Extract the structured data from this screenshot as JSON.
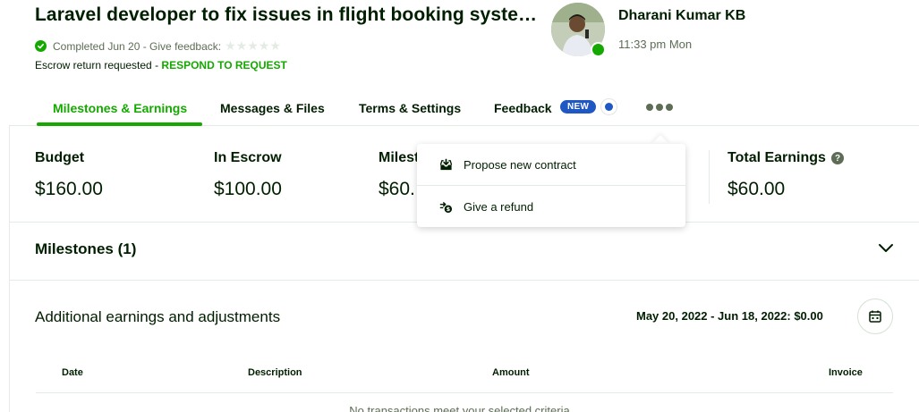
{
  "header": {
    "title": "Laravel developer to fix issues in flight booking syste…",
    "status_text": "Completed Jun 20 - Give feedback:",
    "stars": "★★★★★",
    "escrow_text": "Escrow return requested - ",
    "respond_link": "RESPOND TO REQUEST"
  },
  "user": {
    "name": "Dharani Kumar KB",
    "time": "11:33 pm Mon"
  },
  "tabs": [
    {
      "label": "Milestones & Earnings",
      "active": true
    },
    {
      "label": "Messages & Files"
    },
    {
      "label": "Terms & Settings"
    },
    {
      "label": "Feedback",
      "badge": "NEW"
    }
  ],
  "stats": [
    {
      "label": "Budget",
      "value": "$160.00"
    },
    {
      "label": "In Escrow",
      "value": "$100.00"
    },
    {
      "label": "Milest",
      "value": "$60."
    },
    {
      "label": "Total Earnings",
      "value": "$60.00"
    }
  ],
  "dropdown": {
    "items": [
      {
        "label": "Propose new contract",
        "icon": "inbox-download-icon"
      },
      {
        "label": "Give a refund",
        "icon": "refund-icon"
      }
    ]
  },
  "milestones": {
    "title": "Milestones (1)"
  },
  "additional": {
    "title": "Additional earnings and adjustments",
    "date_range": "May 20, 2022 - Jun 18, 2022: $0.00",
    "columns": [
      "Date",
      "Description",
      "Amount",
      "Invoice"
    ],
    "empty_message": "No transactions meet your selected criteria"
  },
  "colors": {
    "brand_green": "#14a800",
    "badge_blue": "#1f57c3",
    "text_dark": "#001e00",
    "text_muted": "#5e6d55"
  }
}
